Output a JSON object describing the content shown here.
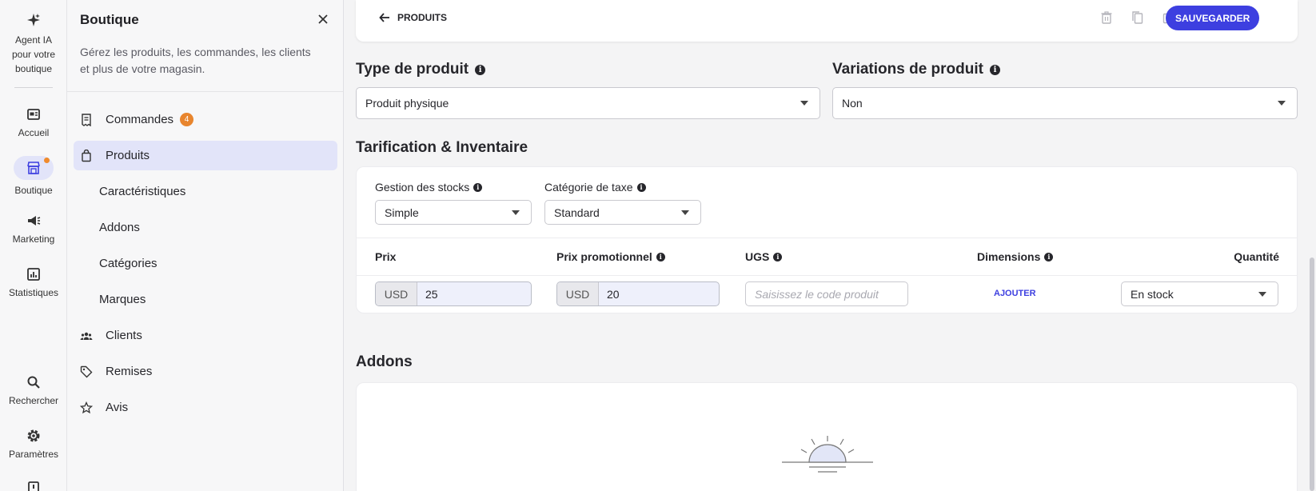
{
  "rail": {
    "items": [
      {
        "label": "Agent IA pour votre boutique",
        "icon": "sparkle-icon"
      },
      {
        "label": "Accueil",
        "icon": "home-icon"
      },
      {
        "label": "Boutique",
        "icon": "store-icon"
      },
      {
        "label": "Marketing",
        "icon": "megaphone-icon"
      },
      {
        "label": "Statistiques",
        "icon": "chart-icon"
      },
      {
        "label": "Rechercher",
        "icon": "search-icon"
      },
      {
        "label": "Paramètres",
        "icon": "gear-icon"
      }
    ],
    "agent_line1": "Agent IA",
    "agent_line2": "pour votre",
    "agent_line3": "boutique"
  },
  "panel": {
    "title": "Boutique",
    "description": "Gérez les produits, les commandes, les clients et plus de votre magasin.",
    "nav": [
      {
        "label": "Commandes",
        "badge": "4"
      },
      {
        "label": "Produits"
      },
      {
        "label": "Caractéristiques"
      },
      {
        "label": "Addons"
      },
      {
        "label": "Catégories"
      },
      {
        "label": "Marques"
      },
      {
        "label": "Clients"
      },
      {
        "label": "Remises"
      },
      {
        "label": "Avis"
      }
    ]
  },
  "topbar": {
    "back_label": "PRODUITS",
    "save_label": "SAUVEGARDER"
  },
  "product_type": {
    "title": "Type de produit",
    "value": "Produit physique"
  },
  "variations": {
    "title": "Variations de produit",
    "value": "Non"
  },
  "pricing": {
    "title": "Tarification & Inventaire",
    "stock_label": "Gestion des stocks",
    "stock_value": "Simple",
    "tax_label": "Catégorie de taxe",
    "tax_value": "Standard",
    "columns": {
      "price": "Prix",
      "promo": "Prix promotionnel",
      "sku": "UGS",
      "dimensions": "Dimensions",
      "quantity": "Quantité"
    },
    "row": {
      "currency": "USD",
      "price": "25",
      "promo_currency": "USD",
      "promo": "20",
      "sku_placeholder": "Saisissez le code produit",
      "dimensions_action": "AJOUTER",
      "quantity": "En stock"
    }
  },
  "addons": {
    "title": "Addons"
  },
  "colors": {
    "accent": "#3d3fe0",
    "badge": "#e8852e",
    "active_bg": "#e2e4f9"
  }
}
